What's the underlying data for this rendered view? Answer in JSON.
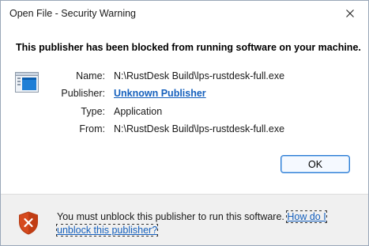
{
  "window": {
    "title": "Open File - Security Warning"
  },
  "main": {
    "headline": "This publisher has been blocked from running software on your machine.",
    "fields": [
      {
        "label": "Name:",
        "value": "N:\\RustDesk Build\\lps-rustdesk-full.exe"
      },
      {
        "label": "Publisher:",
        "value": "Unknown Publisher"
      },
      {
        "label": "Type:",
        "value": "Application"
      },
      {
        "label": "From:",
        "value": "N:\\RustDesk Build\\lps-rustdesk-full.exe"
      }
    ],
    "ok_label": "OK"
  },
  "footer": {
    "message": "You must unblock this publisher to run this software.",
    "link": "How do I unblock this publisher?"
  },
  "icons": {
    "app": "application-window-icon",
    "close": "close-icon",
    "warning": "shield-warning-icon"
  },
  "colors": {
    "link": "#1560bd",
    "shield": "#d64a1e",
    "footer_bg": "#f0f0f0",
    "button_border": "#2b7bd3"
  }
}
